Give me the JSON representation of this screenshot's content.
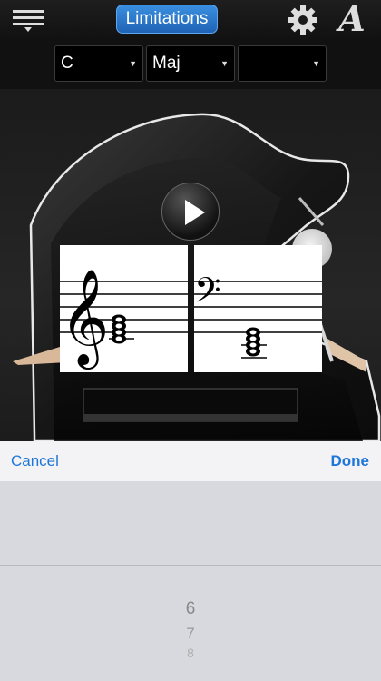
{
  "header": {
    "title": "Limitations"
  },
  "selectors": {
    "root": "C",
    "quality": "Maj",
    "extension": ""
  },
  "sheet": {
    "cancel_label": "Cancel",
    "done_label": "Done"
  },
  "picker": {
    "items": [
      "6",
      "7",
      "8"
    ]
  },
  "colors": {
    "accent": "#1e76d8",
    "title_button": "#2a7bd0"
  }
}
